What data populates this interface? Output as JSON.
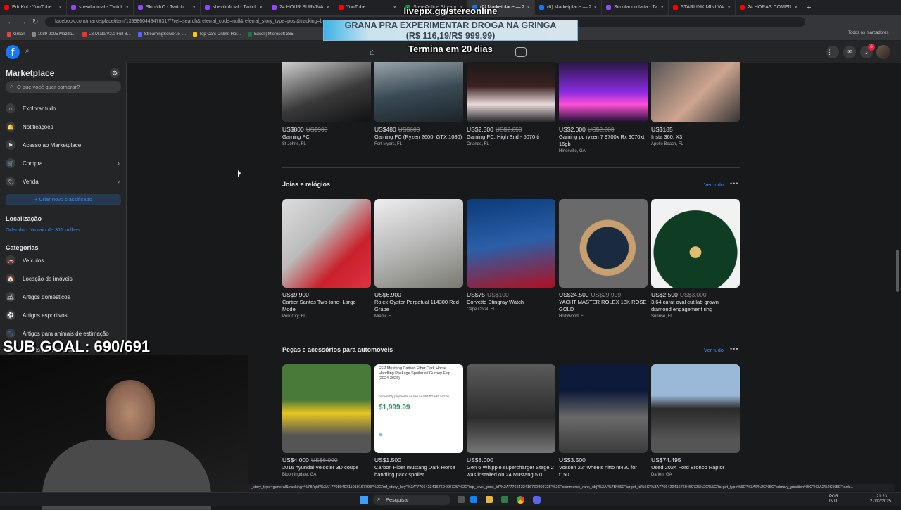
{
  "browser": {
    "tabs": [
      {
        "label": "EduKof - YouTube",
        "color": "#ff0000"
      },
      {
        "label": "shevilioficial - Twitch",
        "color": "#9146ff"
      },
      {
        "label": "SkipNhO - Twitch",
        "color": "#9146ff"
      },
      {
        "label": "shevilioficial - Twitch",
        "color": "#9146ff"
      },
      {
        "label": "24 HOUR SURVIVAL",
        "color": "#9146ff"
      },
      {
        "label": "YouTube",
        "color": "#ff0000"
      },
      {
        "label": "StereOnline Stream",
        "color": "#18a24a"
      },
      {
        "label": "(6) Marketplace — 20",
        "color": "#1877f2"
      },
      {
        "label": "(6) Marketplace — 20",
        "color": "#1877f2"
      },
      {
        "label": "Simulando falta - Twit",
        "color": "#9146ff"
      },
      {
        "label": "STARLINK MINI VALE",
        "color": "#ff0000"
      },
      {
        "label": "24 HORAS COMENDO",
        "color": "#ff0000"
      }
    ],
    "url": "facebook.com/marketplace/item/1399860443476317/?ref=search&referral_code=null&referral_story_type=post&tracking=browse_serp...",
    "bookmarks": [
      {
        "label": "Gmail",
        "color": "#ea4335"
      },
      {
        "label": "1989-2005 Mazda...",
        "color": "#888"
      },
      {
        "label": "LS Miata V2.0 Full B...",
        "color": "#e33"
      },
      {
        "label": "StreamingServer.io |...",
        "color": "#56f"
      },
      {
        "label": "Top Cars Online Hor...",
        "color": "#fc0"
      },
      {
        "label": "Excel | Microsoft 365",
        "color": "#1e7145"
      }
    ],
    "bookmarks_all": "Todos os marcadores"
  },
  "overlay": {
    "site": "livepix.gg/stereonline",
    "goal_title": "GRANA PRA EXPERIMENTAR DROGA NA GRINGA",
    "goal_amount": "(R$ 116,19/R$ 999,99)",
    "ends": "Termina em 20 dias",
    "sub_goal": "SUB GOAL: 690/691"
  },
  "header": {
    "notif_count": "6"
  },
  "sidebar": {
    "title": "Marketplace",
    "search_placeholder": "O que você quer comprar?",
    "items": [
      {
        "label": "Explorar tudo"
      },
      {
        "label": "Notificações"
      },
      {
        "label": "Acesso ao Marketplace"
      },
      {
        "label": "Compra"
      },
      {
        "label": "Venda"
      }
    ],
    "create_button": "+ Criar novo classificado",
    "location_title": "Localização",
    "location_value": "Orlando · No raio de 311 milhas",
    "categories_title": "Categorias",
    "categories": [
      {
        "label": "Veículos"
      },
      {
        "label": "Locação de imóveis"
      },
      {
        "label": "Artigos domésticos"
      },
      {
        "label": "Artigos esportivos"
      },
      {
        "label": "Artigos para animais de estimação"
      },
      {
        "label": "Artigos para escritório"
      }
    ]
  },
  "sections": [
    {
      "title": "",
      "items": [
        {
          "price": "US$800",
          "old": "US$900",
          "title": "Gaming PC",
          "loc": "St Johns, FL"
        },
        {
          "price": "US$480",
          "old": "US$600",
          "title": "Gaming PC (Ryzen 2600, GTX 1080)",
          "loc": "Fort Myers, FL"
        },
        {
          "price": "US$2.500",
          "old": "US$2.650",
          "title": "Gaming PC, High End - 5070 ti",
          "loc": "Orlando, FL"
        },
        {
          "price": "US$2.000",
          "old": "US$2.200",
          "title": "Gaming pc ryzen 7 9700x Rx 9070xt 16gb",
          "loc": "Hinesville, GA"
        },
        {
          "price": "US$185",
          "old": "",
          "title": "Insta 360. X3",
          "loc": "Apollo Beach, FL"
        }
      ]
    },
    {
      "title": "Joias e relógios",
      "see_all": "Ver tudo",
      "items": [
        {
          "price": "US$9.900",
          "old": "",
          "title": "Cartier Santos Two-tone- Large Model",
          "loc": "Polk City, FL"
        },
        {
          "price": "US$6.900",
          "old": "",
          "title": "Rolex Oyster Perpetual 114300 Red Grape",
          "loc": "Miami, FL"
        },
        {
          "price": "US$75",
          "old": "US$100",
          "title": "Corvette Stingray Watch",
          "loc": "Cape Coral, FL"
        },
        {
          "price": "US$24.500",
          "old": "US$29.999",
          "title": "YACHT MASTER ROLEX 18K ROSE GOLD",
          "loc": "Hollywood, FL"
        },
        {
          "price": "US$2.500",
          "old": "US$3.000",
          "title": "3.64 carat oval cut lab grown diamond engagement ring",
          "loc": "Sunrise, FL"
        }
      ]
    },
    {
      "title": "Peças e acessórios para automóveis",
      "see_all": "Ver tudo",
      "items": [
        {
          "price": "US$4.000",
          "old": "US$6.000",
          "title": "2016 hyundai Veloster 3D coupe",
          "loc": "Bloomingdale, GA"
        },
        {
          "price": "US$1.500",
          "old": "",
          "title": "Carbon Fiber mustang Dark Horse handling pack spoiler",
          "loc": ""
        },
        {
          "price": "US$8.000",
          "old": "",
          "title": "Gen 6 Whipple supercharger Stage 2 was installed on 24 Mustang 5.0",
          "loc": ""
        },
        {
          "price": "US$3.500",
          "old": "",
          "title": "Vossen 22” wheels nitto nt420 for f150",
          "loc": ""
        },
        {
          "price": "US$74.495",
          "old": "",
          "title": "Used 2024 Ford Bronco Raptor",
          "loc": "Darien, GA"
        }
      ]
    }
  ],
  "spoiler_ad": {
    "title": "FFP Mustang Carbon Fiber Dark Horse Handling Package Spoiler w/ Gurney Flap (2024-2026)",
    "price": "$1,999.99",
    "note": "or monthly payments as low as $63.00 with sezzle"
  },
  "status_url": "_story_type=general&tracking=%7B\"qid\"%3A\"-7708049711019167793\"%2C\"mf_story_key\"%3A\"7766422416760469725\"%2C\"top_level_post_id\"%3A\"7766422416760469725\"%2C\"commerce_rank_obj\"%3A\"%7B%5C\"target_id%5C\"%3A7766422416760469725%2C%5C\"target_type%5C\"%3A6%2C%5C\"primary_position%5C\"%3A2%2C%5C\"rank...",
  "taskbar": {
    "search": "Pesquisar",
    "lang": "POR",
    "kbd": "INTL",
    "time": "21:23",
    "date": "27/12/2025"
  },
  "colors": {
    "fb_blue": "#1877f2",
    "link_blue": "#2d88ff",
    "bg": "#18191a",
    "panel": "#242526"
  }
}
